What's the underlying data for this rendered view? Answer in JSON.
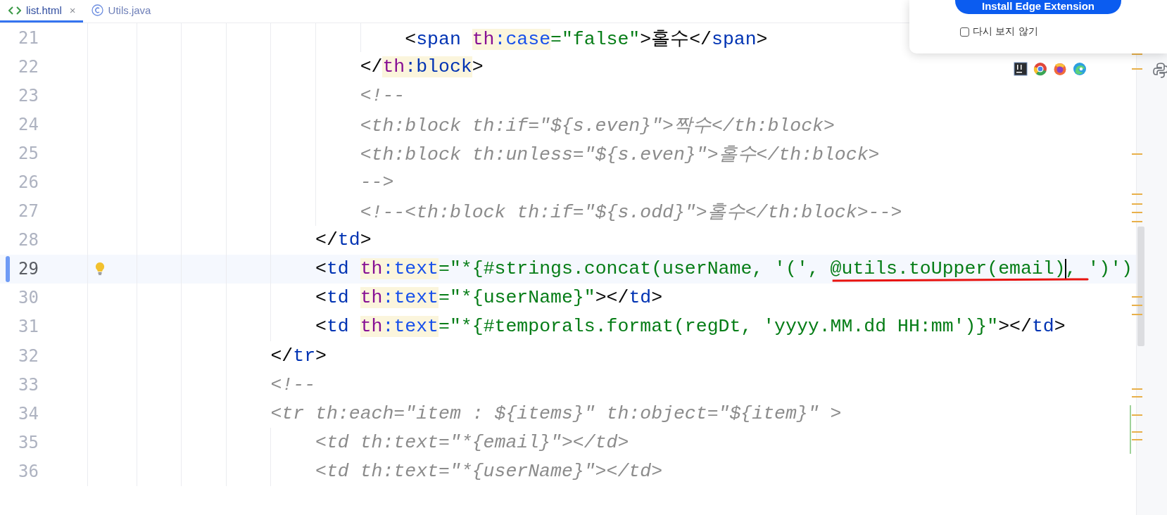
{
  "tabs": [
    {
      "label": "list.html",
      "kind": "html",
      "selected": true,
      "close": "×"
    },
    {
      "label": "Utils.java",
      "kind": "class",
      "selected": false
    }
  ],
  "popup": {
    "button": "Install Edge Extension",
    "checkbox": {
      "label": "다시 보지 않기",
      "checked": false
    }
  },
  "editor": {
    "lines": [
      {
        "number": "21",
        "current": false,
        "modified": false,
        "bulb": false,
        "tokens": [
          {
            "kind": "punct",
            "text": "                            <"
          },
          {
            "kind": "tag",
            "text": "span "
          },
          {
            "kind": "ns",
            "text": "th"
          },
          {
            "kind": "ns-attr",
            "text": ":case"
          },
          {
            "kind": "value",
            "text": "=\"false\""
          },
          {
            "kind": "punct",
            "text": ">홀수</"
          },
          {
            "kind": "tag",
            "text": "span"
          },
          {
            "kind": "punct",
            "text": ">"
          }
        ]
      },
      {
        "number": "22",
        "current": false,
        "modified": false,
        "bulb": false,
        "tokens": [
          {
            "kind": "punct",
            "text": "                        </"
          },
          {
            "kind": "ns",
            "text": "th"
          },
          {
            "kind": "ns-tag",
            "text": ":block"
          },
          {
            "kind": "punct",
            "text": ">"
          }
        ]
      },
      {
        "number": "23",
        "current": false,
        "modified": false,
        "bulb": false,
        "tokens": [
          {
            "kind": "comment",
            "text": "                        <!--"
          }
        ]
      },
      {
        "number": "24",
        "current": false,
        "modified": false,
        "bulb": false,
        "tokens": [
          {
            "kind": "comment",
            "text": "                        <th:block th:if=\"${s.even}\">짝수</th:block>"
          }
        ]
      },
      {
        "number": "25",
        "current": false,
        "modified": false,
        "bulb": false,
        "tokens": [
          {
            "kind": "comment",
            "text": "                        <th:block th:unless=\"${s.even}\">홀수</th:block>"
          }
        ]
      },
      {
        "number": "26",
        "current": false,
        "modified": false,
        "bulb": false,
        "tokens": [
          {
            "kind": "comment",
            "text": "                        -->"
          }
        ]
      },
      {
        "number": "27",
        "current": false,
        "modified": false,
        "bulb": false,
        "tokens": [
          {
            "kind": "comment",
            "text": "                        <!--<th:block th:if=\"${s.odd}\">홀수</th:block>-->"
          }
        ]
      },
      {
        "number": "28",
        "current": false,
        "modified": false,
        "bulb": false,
        "tokens": [
          {
            "kind": "punct",
            "text": "                    </"
          },
          {
            "kind": "tag",
            "text": "td"
          },
          {
            "kind": "punct",
            "text": ">"
          }
        ]
      },
      {
        "number": "29",
        "current": true,
        "modified": true,
        "bulb": true,
        "tokens": [
          {
            "kind": "punct",
            "text": "                    <"
          },
          {
            "kind": "tag",
            "text": "td "
          },
          {
            "kind": "ns",
            "text": "th"
          },
          {
            "kind": "ns-attr",
            "text": ":text"
          },
          {
            "kind": "value",
            "text": "=\"*{#strings.concat(userName, '(', "
          },
          {
            "kind": "marked",
            "text": "@utils.toUpper(email)"
          },
          {
            "kind": "caret"
          },
          {
            "kind": "marked",
            "text": ", "
          },
          {
            "kind": "value",
            "text": "')')"
          }
        ]
      },
      {
        "number": "30",
        "current": false,
        "modified": false,
        "bulb": false,
        "tokens": [
          {
            "kind": "punct",
            "text": "                    <"
          },
          {
            "kind": "tag",
            "text": "td "
          },
          {
            "kind": "ns",
            "text": "th"
          },
          {
            "kind": "ns-attr",
            "text": ":text"
          },
          {
            "kind": "value",
            "text": "=\"*{userName}\""
          },
          {
            "kind": "punct",
            "text": "></"
          },
          {
            "kind": "tag",
            "text": "td"
          },
          {
            "kind": "punct",
            "text": ">"
          }
        ]
      },
      {
        "number": "31",
        "current": false,
        "modified": false,
        "bulb": false,
        "tokens": [
          {
            "kind": "punct",
            "text": "                    <"
          },
          {
            "kind": "tag",
            "text": "td "
          },
          {
            "kind": "ns",
            "text": "th"
          },
          {
            "kind": "ns-attr",
            "text": ":text"
          },
          {
            "kind": "value",
            "text": "=\"*{#temporals.format(regDt, 'yyyy.MM.dd HH:mm')}\""
          },
          {
            "kind": "punct",
            "text": "></"
          },
          {
            "kind": "tag",
            "text": "td"
          },
          {
            "kind": "punct",
            "text": ">"
          }
        ]
      },
      {
        "number": "32",
        "current": false,
        "modified": false,
        "bulb": false,
        "tokens": [
          {
            "kind": "punct",
            "text": "                </"
          },
          {
            "kind": "tag",
            "text": "tr"
          },
          {
            "kind": "punct",
            "text": ">"
          }
        ]
      },
      {
        "number": "33",
        "current": false,
        "modified": false,
        "bulb": false,
        "tokens": [
          {
            "kind": "comment",
            "text": "                <!--"
          }
        ]
      },
      {
        "number": "34",
        "current": false,
        "modified": false,
        "bulb": false,
        "tokens": [
          {
            "kind": "comment",
            "text": "                <tr th:each=\"item : ${items}\" th:object=\"${item}\" >"
          }
        ]
      },
      {
        "number": "35",
        "current": false,
        "modified": false,
        "bulb": false,
        "tokens": [
          {
            "kind": "comment",
            "text": "                    <td th:text=\"*{email}\"></td>"
          }
        ]
      },
      {
        "number": "36",
        "current": false,
        "modified": false,
        "bulb": false,
        "tokens": [
          {
            "kind": "comment",
            "text": "                    <td th:text=\"*{userName}\"></td>"
          }
        ]
      }
    ]
  }
}
